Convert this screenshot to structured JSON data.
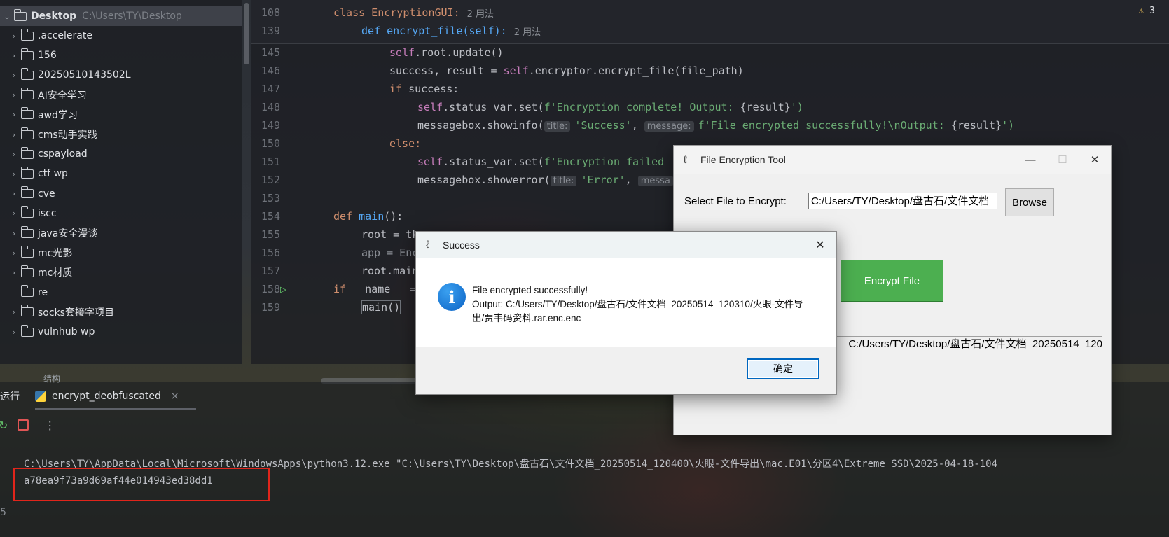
{
  "tree": {
    "root_label": "Desktop",
    "root_path": "C:\\Users\\TY\\Desktop",
    "items": [
      {
        "label": ".accelerate",
        "expandable": true
      },
      {
        "label": "156",
        "expandable": true
      },
      {
        "label": "20250510143502L",
        "expandable": true
      },
      {
        "label": "AI安全学习",
        "expandable": true
      },
      {
        "label": "awd学习",
        "expandable": true
      },
      {
        "label": "cms动手实践",
        "expandable": true
      },
      {
        "label": "cspayload",
        "expandable": true
      },
      {
        "label": "ctf wp",
        "expandable": true
      },
      {
        "label": "cve",
        "expandable": true
      },
      {
        "label": "iscc",
        "expandable": true
      },
      {
        "label": "java安全漫谈",
        "expandable": true
      },
      {
        "label": "mc光影",
        "expandable": true
      },
      {
        "label": "mc材质",
        "expandable": true
      },
      {
        "label": "re",
        "expandable": false
      },
      {
        "label": "socks套接字项目",
        "expandable": true
      },
      {
        "label": "vulnhub wp",
        "expandable": true
      }
    ]
  },
  "editor": {
    "warning_count": "3",
    "sticky": [
      {
        "ln": "108",
        "code": "class EncryptionGUI:",
        "hint": "2 用法"
      },
      {
        "ln": "139",
        "code": "def encrypt_file(self):",
        "hint": "2 用法"
      }
    ],
    "lines": {
      "l145": {
        "ln": "145",
        "a": "self",
        "b": ".root.update()"
      },
      "l146": {
        "ln": "146",
        "a": "success, result = ",
        "b": "self",
        "c": ".encryptor.encrypt_file(file_path)"
      },
      "l147": {
        "ln": "147",
        "a": "if",
        "b": " success:"
      },
      "l148": {
        "ln": "148",
        "a": "self",
        "b": ".status_var.set(",
        "c": "f'Encryption complete! Output: ",
        "d": "{result}",
        "e": "')"
      },
      "l149": {
        "ln": "149",
        "a": "messagebox.showinfo(",
        "p1": "title:",
        "s1": "'Success'",
        "comma": ", ",
        "p2": "message:",
        "s2": "f'File encrypted successfully!\\nOutput: ",
        "d": "{result}",
        "e": "')"
      },
      "l150": {
        "ln": "150",
        "a": "else:"
      },
      "l151": {
        "ln": "151",
        "a": "self",
        "b": ".status_var.set(",
        "c": "f'Encryption failed"
      },
      "l152": {
        "ln": "152",
        "a": "messagebox.showerror(",
        "p1": "title:",
        "s1": "'Error'",
        "comma": ", ",
        "p2": "messa"
      },
      "l153": {
        "ln": "153"
      },
      "l154": {
        "ln": "154",
        "a": "def",
        "b": " main",
        "c": "():"
      },
      "l155": {
        "ln": "155",
        "a": "root = tk."
      },
      "l156": {
        "ln": "156",
        "a": "app = Encr"
      },
      "l157": {
        "ln": "157",
        "a": "root.mainl"
      },
      "l158": {
        "ln": "158",
        "a": "if",
        "b": " __name__ == "
      },
      "l159": {
        "ln": "159",
        "a": "main()"
      }
    }
  },
  "run_panel": {
    "left_label": "运行",
    "tab_label": "encrypt_deobfuscated",
    "tab_close": "×",
    "console": [
      "C:\\Users\\TY\\AppData\\Local\\Microsoft\\WindowsApps\\python3.12.exe \"C:\\Users\\TY\\Desktop\\盘古石\\文件文档_20250514_120400\\火眼-文件导出\\mac.E01\\分区4\\Extreme SSD\\2025-04-18-104",
      "a78ea9f73a9d69af44e014943ed38dd1"
    ],
    "gutter_digit": "5",
    "structure_label": "结构"
  },
  "tk_window": {
    "title": "File Encryption Tool",
    "select_label": "Select File to Encrypt:",
    "entry_value": "C:/Users/TY/Desktop/盘古石/文件文档",
    "browse_label": "Browse",
    "encrypt_label": "Encrypt File",
    "status_text": "C:/Users/TY/Desktop/盘古石/文件文档_20250514_120"
  },
  "msgbox": {
    "title": "Success",
    "line1": "File encrypted successfully!",
    "line2": "Output: C:/Users/TY/Desktop/盘古石/文件文档_20250514_120310/火眼-文件导出/贾韦码资料.rar.enc.enc",
    "ok_label": "确定"
  }
}
